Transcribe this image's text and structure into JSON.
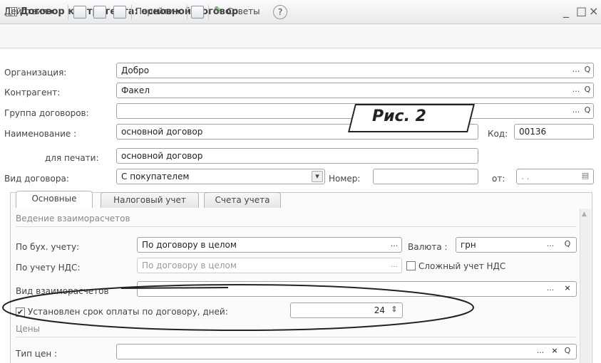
{
  "window": {
    "title": "Договор контрагента: основной договор",
    "controls": {
      "minimize": "_",
      "maximize": "□",
      "close": "×"
    }
  },
  "toolbar": {
    "actions_label": "Действия ▾",
    "goto_label": "Перейти ▾",
    "tips_label": "Советы",
    "help_label": "?"
  },
  "form": {
    "organization": {
      "label": "Организация:",
      "value": "Добро"
    },
    "counterparty": {
      "label": "Контрагент:",
      "value": "Факел"
    },
    "contract_group": {
      "label": "Группа договоров:",
      "value": ""
    },
    "name": {
      "label": "Наименование :",
      "value": "основной договор"
    },
    "code": {
      "label": "Код:",
      "value": "00136"
    },
    "print_name": {
      "label": "для печати:",
      "value": "основной договор"
    },
    "contract_type": {
      "label": "Вид договора:",
      "value": "С покупателем"
    },
    "number": {
      "label": "Номер:",
      "value": ""
    },
    "date_from": {
      "label": "от:",
      "value": ". ."
    }
  },
  "callout": {
    "text": "Рис. 2"
  },
  "tabs": [
    {
      "label": "Основные"
    },
    {
      "label": "Налоговый учет"
    },
    {
      "label": "Счета учета"
    }
  ],
  "main_tab": {
    "settlements_section": "Ведение взаиморасчетов",
    "accounting": {
      "label": "По бух. учету:",
      "value": "По договору в целом"
    },
    "currency": {
      "label": "Валюта :",
      "value": "грн"
    },
    "vat_accounting": {
      "label": "По учету НДС:",
      "value": "По договору в целом"
    },
    "complex_vat": {
      "label": "Сложный учет НДС",
      "checked": false
    },
    "settlement_type": {
      "label": "Вид взаиморасчетов",
      "value": ""
    },
    "payment_term": {
      "label": "Установлен срок оплаты по договору, дней:",
      "checked": true,
      "value": "24"
    },
    "prices_section": "Цены",
    "price_type": {
      "label": "Тип цен :",
      "value": ""
    }
  },
  "icons": {
    "lookup": "...",
    "search": "Q",
    "clear": "×",
    "dropdown": "▾",
    "spin": "⇕"
  }
}
